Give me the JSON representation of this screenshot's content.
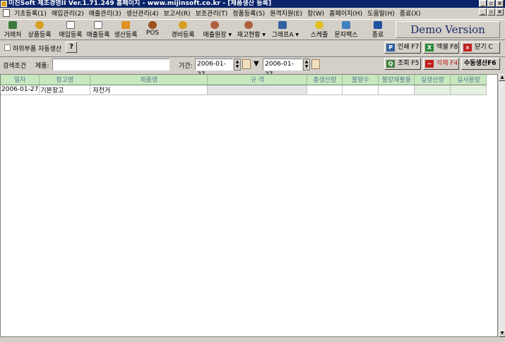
{
  "window": {
    "title": "미진Soft 제조경영II Ver.1.71.249      홈페이지 - www.mijinsoft.co.kr - [제품생산 등록]",
    "btn_min": "_",
    "btn_max": "▫",
    "btn_close": "×"
  },
  "menu": [
    "기초등록(1)",
    "매입관리(2)",
    "매출관리(3)",
    "생산관리(4)",
    "보고서(R)",
    "보조관리(T)",
    "정품등록(S)",
    "원격지원(E)",
    "창(W)",
    "홈페이지(H)",
    "도움말(H)",
    "종료(X)"
  ],
  "toolbar": {
    "items": [
      {
        "label": "거래처",
        "icon": "edit-icon",
        "color": "#3a7a3a"
      },
      {
        "label": "상품등록",
        "icon": "box-icon",
        "color": "#d8a020"
      },
      {
        "label": "매입등록",
        "icon": "doc-icon",
        "color": "#7a7a7a"
      },
      {
        "label": "매출등록",
        "icon": "doc-icon",
        "color": "#7a7a7a"
      },
      {
        "label": "생산등록",
        "icon": "factory-icon",
        "color": "#e09020"
      },
      {
        "label": "POS",
        "icon": "pos-icon",
        "color": "#a05020"
      },
      {
        "label": "경비등록",
        "icon": "coin-icon",
        "color": "#d8a020"
      },
      {
        "label": "매출원장",
        "icon": "ledger-icon",
        "color": "#b06040"
      },
      {
        "label": "재고현황",
        "icon": "stock-icon",
        "color": "#b06040"
      },
      {
        "label": "그래프A",
        "icon": "chart-icon",
        "color": "#3060a0"
      },
      {
        "label": "스케쥴",
        "icon": "clock-icon",
        "color": "#e0c020"
      },
      {
        "label": "문자팩스",
        "icon": "phone-icon",
        "color": "#4080c0"
      },
      {
        "label": "종료",
        "icon": "exit-icon",
        "color": "#2050a0"
      }
    ],
    "demo": "Demo Version"
  },
  "options": {
    "auto_produce_label": "하위부품 자동생산",
    "help": "?"
  },
  "actions": {
    "print": "인쇄 F7",
    "excel": "엑셀 F8",
    "close": "닫기 C",
    "search": "조회 F5",
    "delete": "삭제 F4",
    "manual": "수동생산F6"
  },
  "search": {
    "condition_label": "검색조건",
    "product_label": "제품:",
    "product_value": "",
    "period_label": "기간:",
    "date_from": "2006-01-27",
    "date_to": "2006-01-27"
  },
  "grid": {
    "columns": [
      "일자",
      "창고명",
      "제품명",
      "규 격",
      "총생산량",
      "불량수",
      "불량재활용",
      "실생산량",
      "실사용량"
    ],
    "rows": [
      [
        "2006-01-27",
        "기본창고",
        "자전거",
        "",
        "",
        "",
        "",
        "",
        ""
      ]
    ]
  }
}
